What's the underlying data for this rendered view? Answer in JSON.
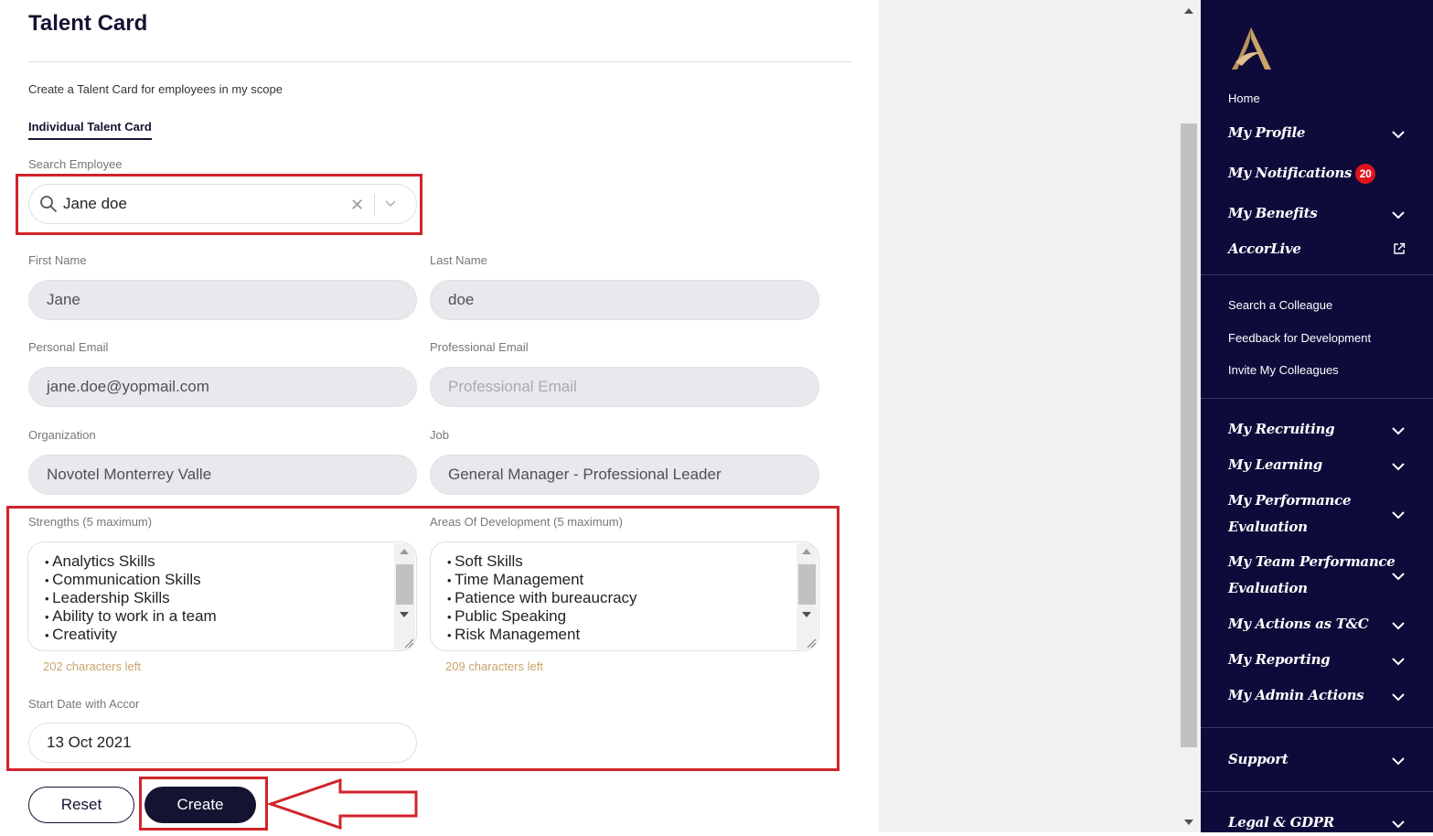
{
  "page": {
    "title": "Talent Card",
    "subtitle": "Create a Talent Card for employees in my scope",
    "tab": "Individual Talent Card"
  },
  "search": {
    "label": "Search Employee",
    "value": "Jane doe"
  },
  "form": {
    "first_name": {
      "label": "First Name",
      "value": "Jane"
    },
    "last_name": {
      "label": "Last Name",
      "value": "doe"
    },
    "personal_email": {
      "label": "Personal Email",
      "value": "jane.doe@yopmail.com"
    },
    "professional_email": {
      "label": "Professional Email",
      "placeholder": "Professional Email"
    },
    "organization": {
      "label": "Organization",
      "value": "Novotel Monterrey Valle"
    },
    "job": {
      "label": "Job",
      "value": "General Manager - Professional Leader"
    },
    "strengths": {
      "label": "Strengths (5 maximum)",
      "items": [
        "Analytics Skills",
        "Communication Skills",
        "Leadership Skills",
        "Ability to work in a team",
        "Creativity"
      ],
      "chars_left": "202 characters left"
    },
    "development": {
      "label": "Areas Of Development (5 maximum)",
      "items": [
        "Soft Skills",
        "Time Management",
        "Patience with bureaucracy",
        "Public Speaking",
        "Risk Management"
      ],
      "chars_left": "209 characters left"
    },
    "start_date": {
      "label": "Start Date with Accor",
      "value": "13 Oct 2021"
    }
  },
  "buttons": {
    "reset": "Reset",
    "create": "Create"
  },
  "sidebar": {
    "home": "Home",
    "my_profile": "My Profile",
    "my_notifications": "My Notifications",
    "notifications_count": "20",
    "my_benefits": "My Benefits",
    "accorlive": "AccorLive",
    "search_colleague": "Search a Colleague",
    "feedback": "Feedback for Development",
    "invite": "Invite My Colleagues",
    "my_recruiting": "My Recruiting",
    "my_learning": "My Learning",
    "my_performance_1": "My Performance",
    "my_performance_2": "Evaluation",
    "my_team_performance_1": "My Team Performance",
    "my_team_performance_2": "Evaluation",
    "my_actions": "My Actions as T&C",
    "my_reporting": "My Reporting",
    "my_admin": "My Admin Actions",
    "support": "Support",
    "legal": "Legal & GDPR"
  },
  "colors": {
    "navy": "#0e0b3b",
    "highlight_red": "#d2232a",
    "chars_left": "#c9a46a",
    "badge_red": "#e0131c",
    "logo_gold": "#c9a46a"
  }
}
